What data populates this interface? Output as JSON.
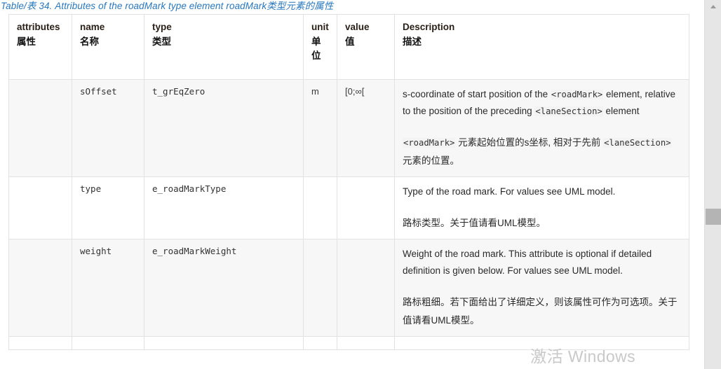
{
  "caption": "Table/表 34. Attributes of the roadMark type element roadMark类型元素的属性",
  "colors": {
    "caption": "#2878be",
    "row_shade": "#f7f7f7",
    "border": "#e2e2e2",
    "scrollbar_track": "#e6e6e6",
    "scrollbar_thumb": "#b4b4b4",
    "watermark": "#c9c9c9"
  },
  "table": {
    "headers": [
      {
        "en": "attributes",
        "zh": "属性"
      },
      {
        "en": "name",
        "zh": "名称"
      },
      {
        "en": "type",
        "zh": "类型"
      },
      {
        "en": "unit",
        "zh": "单位"
      },
      {
        "en": "value",
        "zh": "值"
      },
      {
        "en": "Description",
        "zh": "描述"
      }
    ],
    "rows": [
      {
        "attributes": "",
        "name": "sOffset",
        "type": "t_grEqZero",
        "unit": "m",
        "value": "[0;∞[",
        "desc_en_parts": [
          {
            "t": "text",
            "v": "s-coordinate of start position of the "
          },
          {
            "t": "code",
            "v": "<roadMark>"
          },
          {
            "t": "text",
            "v": " element, relative to the position of the preceding "
          },
          {
            "t": "code",
            "v": "<laneSection>"
          },
          {
            "t": "text",
            "v": " element"
          }
        ],
        "desc_zh_parts": [
          {
            "t": "code",
            "v": "<roadMark>"
          },
          {
            "t": "text",
            "v": " 元素起始位置的s坐标, 相对于先前 "
          },
          {
            "t": "code",
            "v": "<laneSection>"
          },
          {
            "t": "text",
            "v": " 元素的位置。"
          }
        ]
      },
      {
        "attributes": "",
        "name": "type",
        "type": "e_roadMarkType",
        "unit": "",
        "value": "",
        "desc_en_parts": [
          {
            "t": "text",
            "v": "Type of the road mark. For values see UML model."
          }
        ],
        "desc_zh_parts": [
          {
            "t": "text",
            "v": "路标类型。关于值请看UML模型。"
          }
        ]
      },
      {
        "attributes": "",
        "name": "weight",
        "type": "e_roadMarkWeight",
        "unit": "",
        "value": "",
        "desc_en_parts": [
          {
            "t": "text",
            "v": "Weight of the road mark. This attribute is optional if detailed definition is given below. For values see UML model."
          }
        ],
        "desc_zh_parts": [
          {
            "t": "text",
            "v": "路标粗细。若下面给出了详细定义，则该属性可作为可选项。关于值请看UML模型。"
          }
        ]
      },
      {
        "attributes": "",
        "name": "",
        "type": "",
        "unit": "",
        "value": "",
        "desc_en_parts": [],
        "desc_zh_parts": []
      }
    ]
  },
  "watermark": {
    "text": "激活 Windows"
  },
  "scrollbar": {
    "up_arrow": "chevron-up-icon"
  }
}
